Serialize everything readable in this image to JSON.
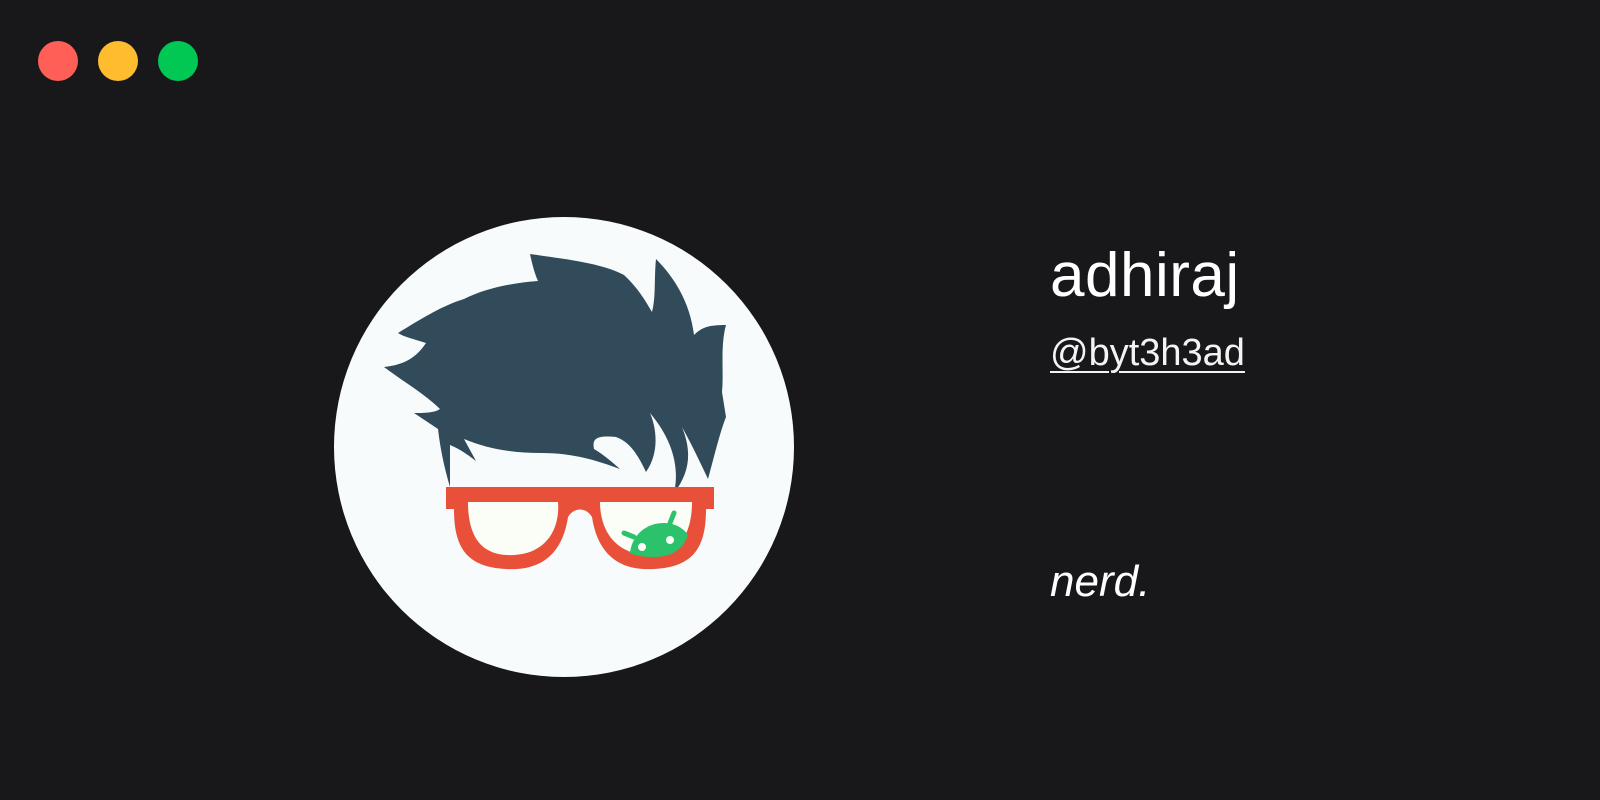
{
  "window": {
    "controls": [
      {
        "name": "close",
        "color": "#ff5f57"
      },
      {
        "name": "minimize",
        "color": "#febc2e"
      },
      {
        "name": "maximize",
        "color": "#00c853"
      }
    ],
    "background": "#18181b"
  },
  "profile": {
    "name": "adhiraj",
    "handle": "@byt3h3ad",
    "bio": "nerd."
  },
  "avatar": {
    "description_icon": "nerd-avatar-icon",
    "colors": {
      "background": "#f7fbfb",
      "hair": "#324b5a",
      "glasses": "#e8503a",
      "android": "#2bc26b"
    }
  }
}
